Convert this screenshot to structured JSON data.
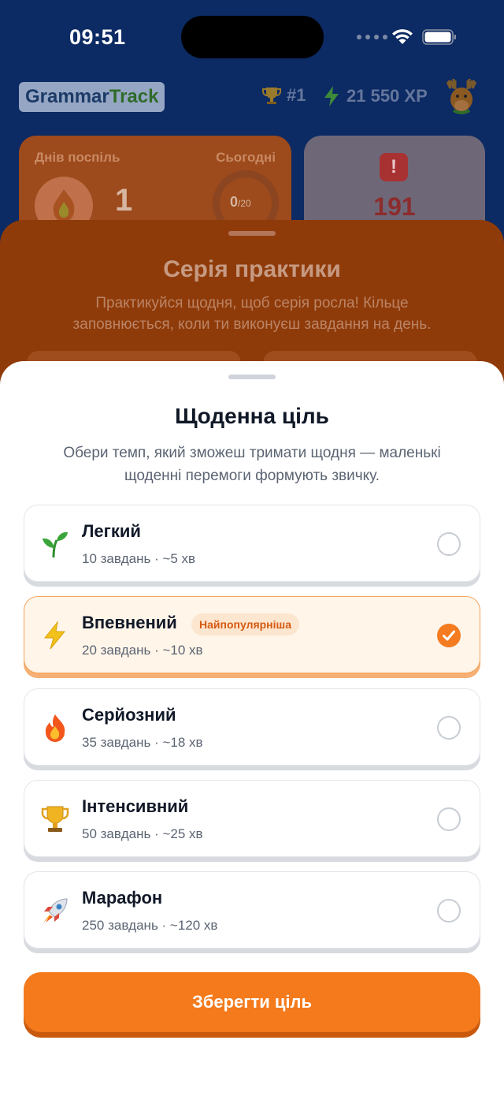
{
  "status_bar": {
    "time": "09:51"
  },
  "header": {
    "logo_part1": "Grammar",
    "logo_part2": "Track",
    "rank": "#1",
    "xp": "21 550 XP"
  },
  "stats": {
    "streak_label": "Днів поспіль",
    "today_label": "Сьогодні",
    "streak_value": "1",
    "today_progress": "0",
    "today_total": "/20",
    "mistakes_value": "191"
  },
  "streak_sheet": {
    "title": "Серія практики",
    "description": "Практикуйся щодня, щоб серія росла! Кільце заповнюється, коли ти виконуєш завдання на день."
  },
  "goal_sheet": {
    "title": "Щоденна ціль",
    "description": "Обери темп, який зможеш тримати щодня — маленькі щоденні перемоги формують звичку.",
    "options": [
      {
        "name": "Легкий",
        "meta": "10 завдань · ~5 хв",
        "icon": "sprout-icon",
        "selected": false
      },
      {
        "name": "Впевнений",
        "meta": "20 завдань · ~10 хв",
        "icon": "lightning-icon",
        "badge": "Найпопулярніша",
        "selected": true
      },
      {
        "name": "Серйозний",
        "meta": "35 завдань · ~18 хв",
        "icon": "fire-icon",
        "selected": false
      },
      {
        "name": "Інтенсивний",
        "meta": "50 завдань · ~25 хв",
        "icon": "trophy-icon",
        "selected": false
      },
      {
        "name": "Марафон",
        "meta": "250 завдань · ~120 хв",
        "icon": "rocket-icon",
        "selected": false
      }
    ],
    "save_label": "Зберегти ціль"
  },
  "colors": {
    "accent": "#f47a1c",
    "selected_bg": "#fff5e9",
    "background": "#0c2a63"
  }
}
